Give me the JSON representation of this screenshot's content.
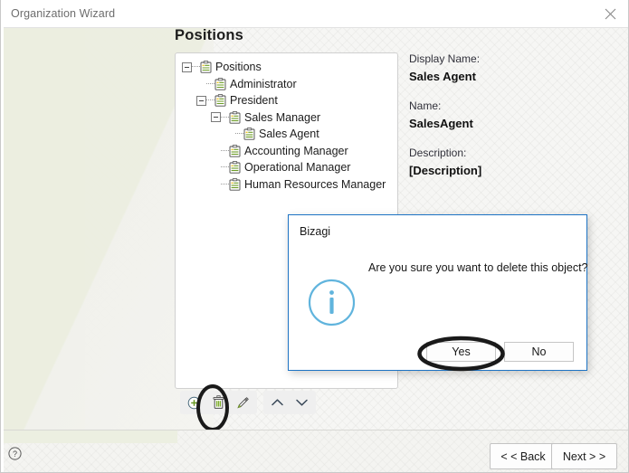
{
  "window": {
    "title": "Organization Wizard",
    "close_icon": "close-icon"
  },
  "page": {
    "title": "Positions"
  },
  "tree": {
    "items": [
      {
        "label": "Positions",
        "depth": 0,
        "expander": "minus",
        "icon": "position-clipboard-icon"
      },
      {
        "label": "Administrator",
        "depth": 1,
        "expander": "none",
        "icon": "position-clipboard-icon"
      },
      {
        "label": "President",
        "depth": 1,
        "expander": "minus",
        "icon": "position-clipboard-icon"
      },
      {
        "label": "Sales Manager",
        "depth": 2,
        "expander": "minus",
        "icon": "position-clipboard-icon"
      },
      {
        "label": "Sales Agent",
        "depth": 3,
        "expander": "none",
        "icon": "position-clipboard-icon"
      },
      {
        "label": "Accounting Manager",
        "depth": 2,
        "expander": "none",
        "icon": "position-clipboard-icon"
      },
      {
        "label": "Operational Manager",
        "depth": 2,
        "expander": "none",
        "icon": "position-clipboard-icon"
      },
      {
        "label": "Human Resources Manager",
        "depth": 2,
        "expander": "none",
        "icon": "position-clipboard-icon"
      }
    ]
  },
  "tree_toolbar": {
    "add": {
      "icon": "add-circle-icon",
      "tooltip": "Add"
    },
    "delete": {
      "icon": "trash-icon",
      "tooltip": "Delete"
    },
    "edit": {
      "icon": "pencil-icon",
      "tooltip": "Edit"
    },
    "move_up": {
      "icon": "chevron-up-icon",
      "tooltip": "Move up"
    },
    "move_down": {
      "icon": "chevron-down-icon",
      "tooltip": "Move down"
    }
  },
  "detail": {
    "display_name_label": "Display Name:",
    "display_name_value": "Sales Agent",
    "name_label": "Name:",
    "name_value": "SalesAgent",
    "description_label": "Description:",
    "description_value": "[Description]"
  },
  "dialog": {
    "title": "Bizagi",
    "message": "Are you sure you want to delete this object?",
    "info_icon": "info-circle-icon",
    "yes_label": "Yes",
    "no_label": "No",
    "border_color": "#1d73c4",
    "info_color": "#60b4dd"
  },
  "footer": {
    "help_icon": "help-circle-icon",
    "back_label": "< < Back",
    "next_label": "Next > >"
  },
  "annotations": {
    "highlight_color": "#1a1a1a",
    "targets": [
      "trash-icon",
      "yes-button"
    ]
  }
}
